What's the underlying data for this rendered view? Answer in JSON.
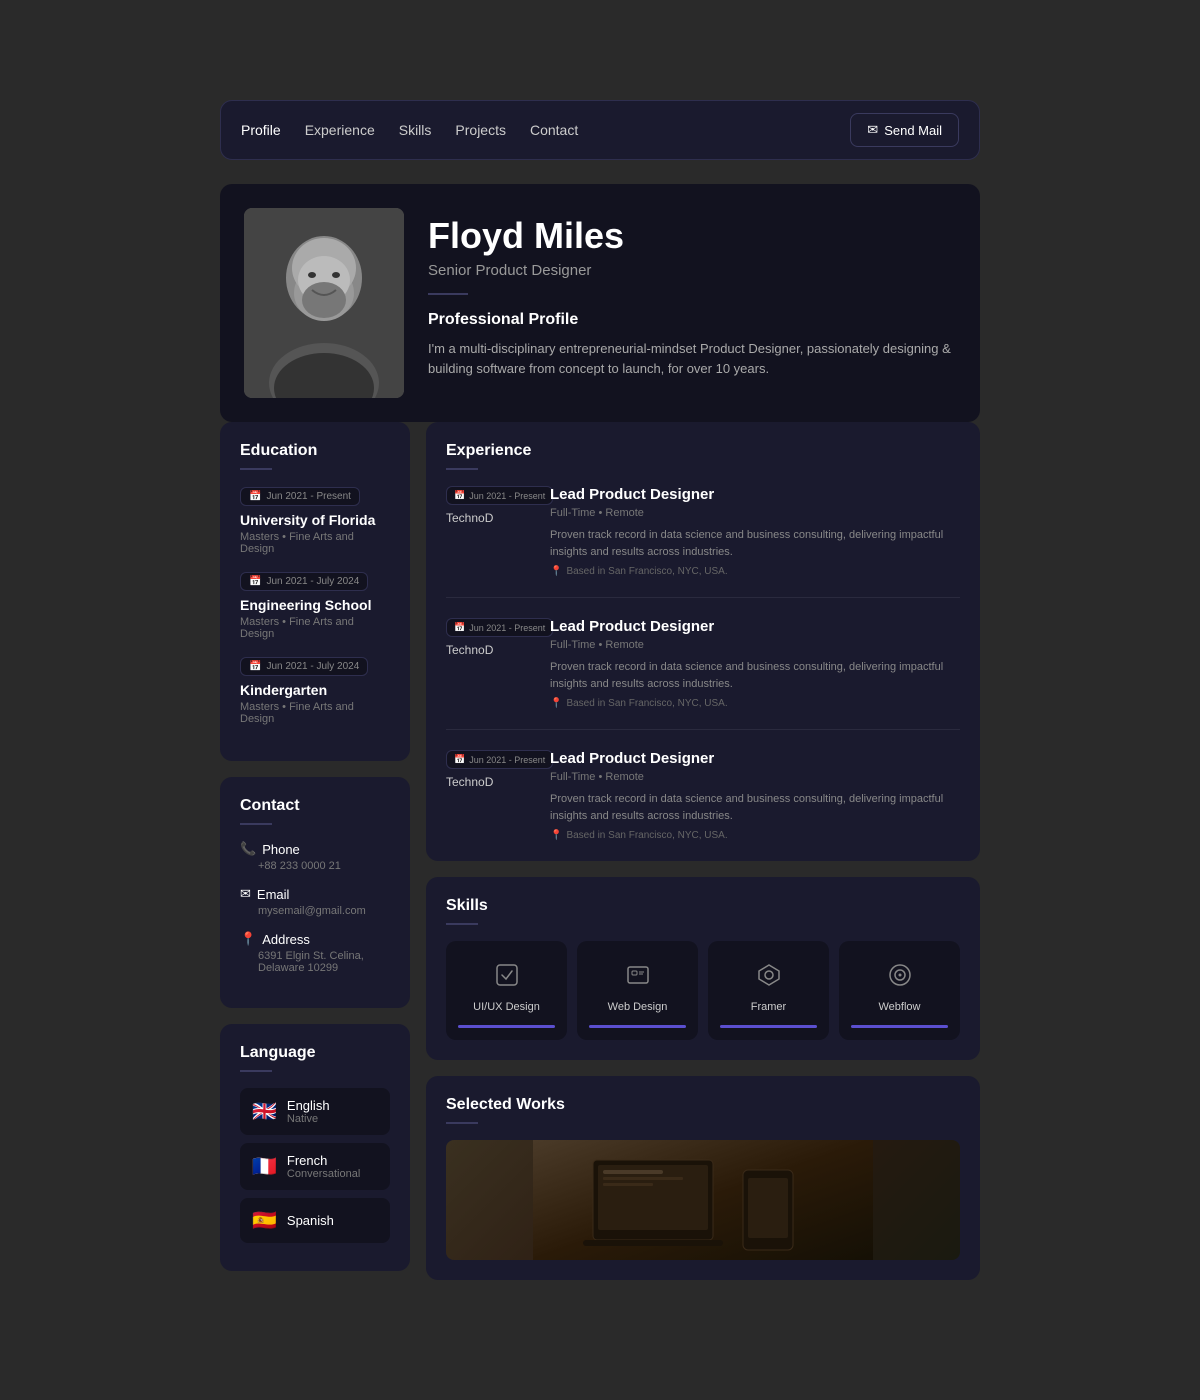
{
  "navbar": {
    "links": [
      {
        "label": "Profile",
        "active": true
      },
      {
        "label": "Experience",
        "active": false
      },
      {
        "label": "Skills",
        "active": false
      },
      {
        "label": "Projects",
        "active": false
      },
      {
        "label": "Contact",
        "active": false
      }
    ],
    "send_mail_label": "Send Mail"
  },
  "profile": {
    "name": "Floyd Miles",
    "title": "Senior Product Designer",
    "professional_profile_heading": "Professional Profile",
    "bio": "I'm a multi-disciplinary entrepreneurial-mindset Product Designer, passionately designing & building software from concept to launch, for over 10 years."
  },
  "education": {
    "section_title": "Education",
    "items": [
      {
        "date": "Jun 2021 - Present",
        "school": "University of Florida",
        "degree": "Masters  •  Fine Arts and Design"
      },
      {
        "date": "Jun 2021 - July 2024",
        "school": "Engineering School",
        "degree": "Masters  •  Fine Arts and Design"
      },
      {
        "date": "Jun 2021 - July 2024",
        "school": "Kindergarten",
        "degree": "Masters  •  Fine Arts and Design"
      }
    ]
  },
  "contact": {
    "section_title": "Contact",
    "phone_label": "Phone",
    "phone_value": "+88 233 0000 21",
    "email_label": "Email",
    "email_value": "mysemail@gmail.com",
    "address_label": "Address",
    "address_value": "6391 Elgin St. Celina, Delaware 10299"
  },
  "language": {
    "section_title": "Language",
    "items": [
      {
        "flag": "🇬🇧",
        "name": "English",
        "level": "Native"
      },
      {
        "flag": "🇫🇷",
        "name": "French",
        "level": "Conversational"
      },
      {
        "flag": "🇪🇸",
        "name": "Spanish",
        "level": ""
      }
    ]
  },
  "experience": {
    "section_title": "Experience",
    "items": [
      {
        "date": "Jun 2021 - Present",
        "company": "TechnoD",
        "role": "Lead Product Designer",
        "type": "Full-Time  •  Remote",
        "description": "Proven track record in data science and business consulting, delivering impactful insights and results across industries.",
        "location": "Based in San Francisco, NYC, USA."
      },
      {
        "date": "Jun 2021 - Present",
        "company": "TechnoD",
        "role": "Lead Product Designer",
        "type": "Full-Time  •  Remote",
        "description": "Proven track record in data science and business consulting, delivering impactful insights and results across industries.",
        "location": "Based in San Francisco, NYC, USA."
      },
      {
        "date": "Jun 2021 - Present",
        "company": "TechnoD",
        "role": "Lead Product Designer",
        "type": "Full-Time  •  Remote",
        "description": "Proven track record in data science and business consulting, delivering impactful insights and results across industries.",
        "location": "Based in San Francisco, NYC, USA."
      }
    ]
  },
  "skills": {
    "section_title": "Skills",
    "items": [
      {
        "name": "UI/UX Design",
        "icon": "✏️"
      },
      {
        "name": "Web Design",
        "icon": "⬛"
      },
      {
        "name": "Framer",
        "icon": "🔷"
      },
      {
        "name": "Webflow",
        "icon": "⓪"
      }
    ]
  },
  "selected_works": {
    "section_title": "Selected Works"
  }
}
